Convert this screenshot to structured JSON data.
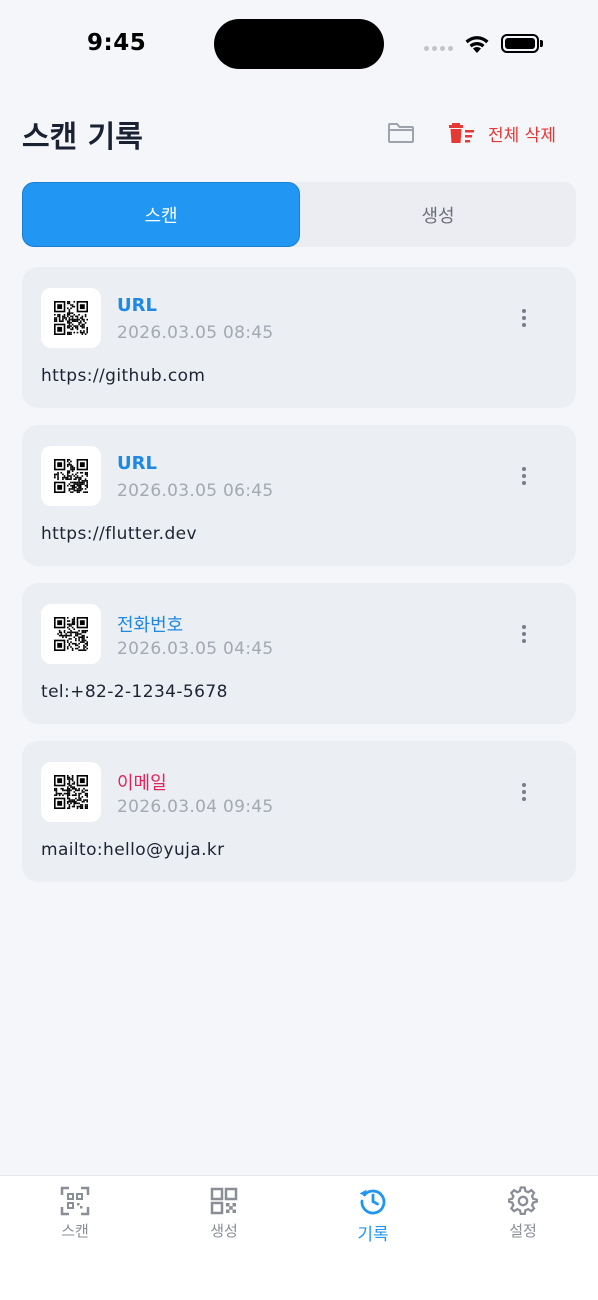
{
  "status_bar": {
    "time": "9:45"
  },
  "header": {
    "title": "스캔 기록",
    "delete_all_label": "전체 삭제"
  },
  "segments": {
    "scan": "스캔",
    "generate": "생성",
    "active": "scan"
  },
  "history": [
    {
      "type": "URL",
      "time": "2026.03.05 08:45",
      "content": "https://github.com"
    },
    {
      "type": "URL",
      "time": "2026.03.05 06:45",
      "content": "https://flutter.dev"
    },
    {
      "type": "전화번호",
      "time": "2026.03.05 04:45",
      "content": "tel:+82-2-1234-5678"
    },
    {
      "type": "이메일",
      "time": "2026.03.04 09:45",
      "content": "mailto:hello@yuja.kr"
    }
  ],
  "bottom_nav": [
    {
      "label": "스캔",
      "icon": "qr-scan-icon"
    },
    {
      "label": "생성",
      "icon": "qr-generate-icon"
    },
    {
      "label": "기록",
      "icon": "history-icon",
      "active": true
    },
    {
      "label": "설정",
      "icon": "gear-icon"
    }
  ],
  "colors": {
    "accent": "#2196f3",
    "danger": "#e53935",
    "email": "#e0245e"
  }
}
